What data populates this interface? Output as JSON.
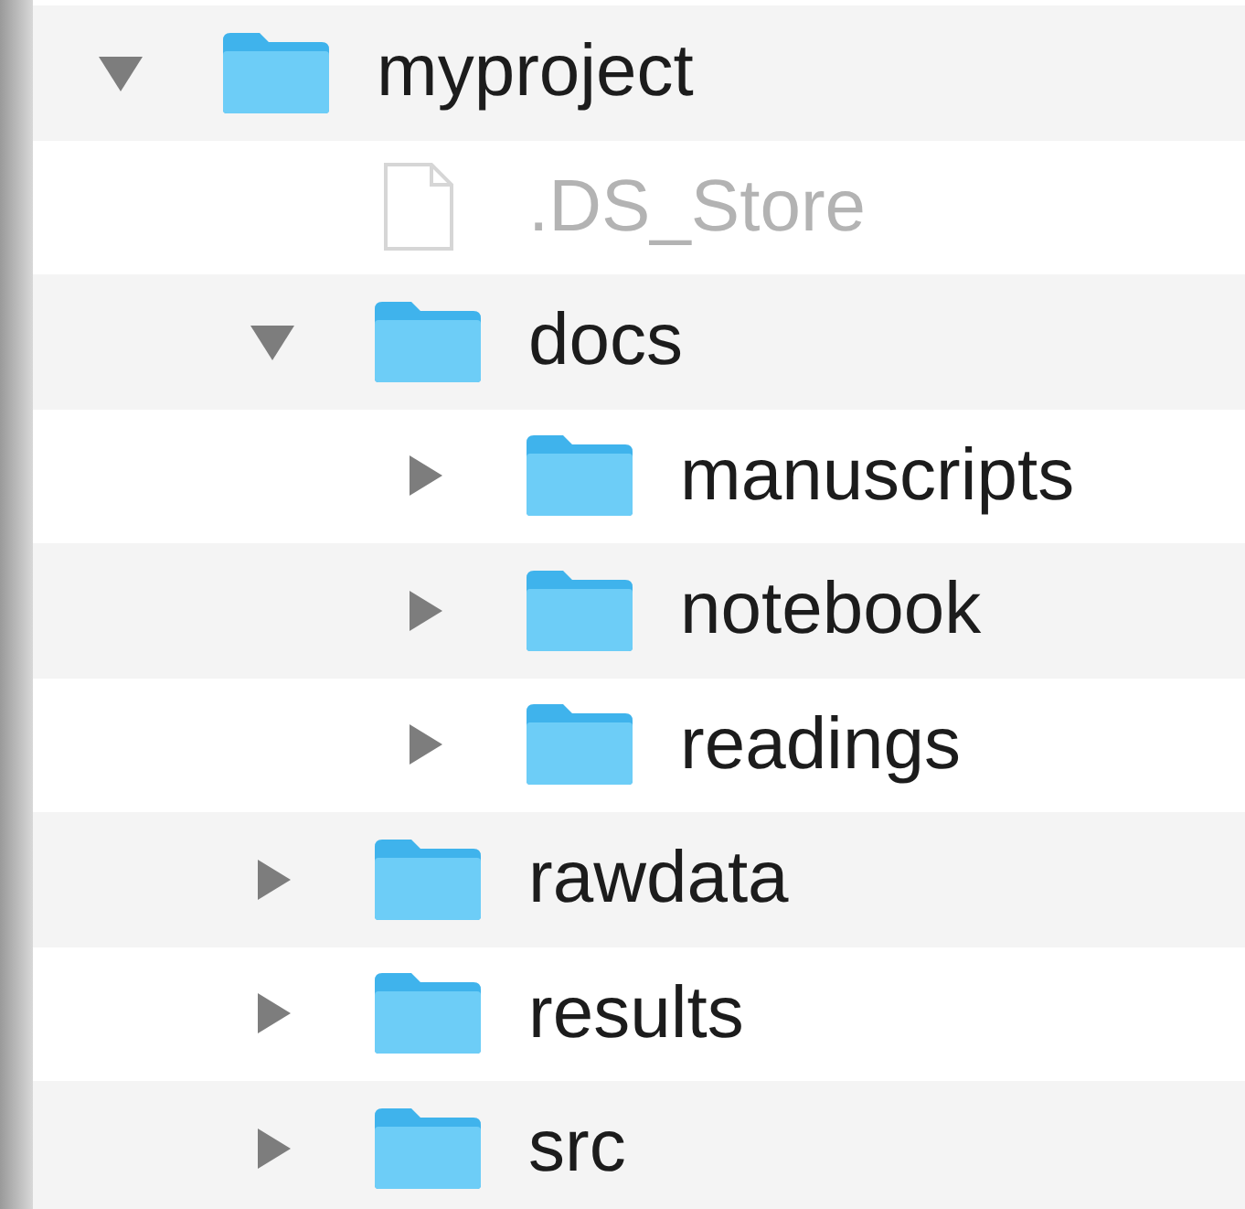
{
  "tree": [
    {
      "kind": "folder",
      "name": "myproject",
      "expanded": true,
      "dimmed": false,
      "children": [
        {
          "kind": "file",
          "name": ".DS_Store",
          "dimmed": true
        },
        {
          "kind": "folder",
          "name": "docs",
          "expanded": true,
          "dimmed": false,
          "children": [
            {
              "kind": "folder",
              "name": "manuscripts",
              "expanded": false,
              "dimmed": false
            },
            {
              "kind": "folder",
              "name": "notebook",
              "expanded": false,
              "dimmed": false
            },
            {
              "kind": "folder",
              "name": "readings",
              "expanded": false,
              "dimmed": false
            }
          ]
        },
        {
          "kind": "folder",
          "name": "rawdata",
          "expanded": false,
          "dimmed": false
        },
        {
          "kind": "folder",
          "name": "results",
          "expanded": false,
          "dimmed": false
        },
        {
          "kind": "folder",
          "name": "src",
          "expanded": false,
          "dimmed": false
        }
      ]
    }
  ]
}
